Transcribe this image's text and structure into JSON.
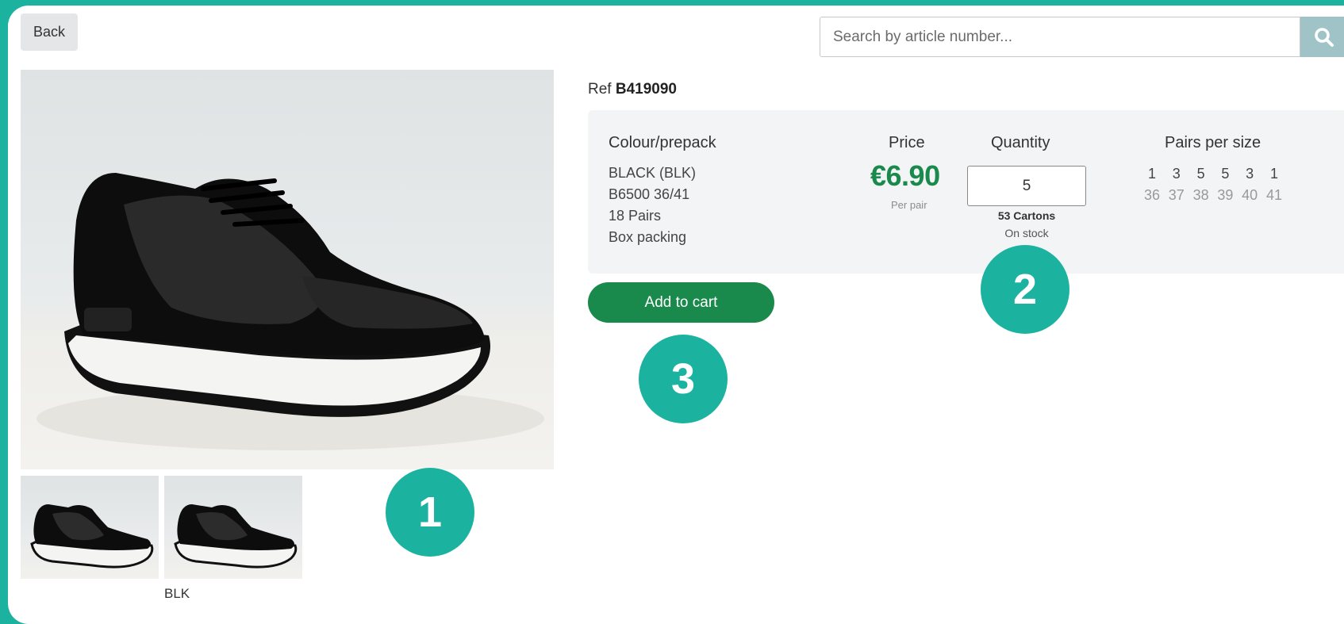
{
  "header": {
    "back_label": "Back",
    "search": {
      "placeholder": "Search by article number...",
      "value": ""
    }
  },
  "product": {
    "ref_prefix": "Ref",
    "ref_number": "B419090",
    "thumb_label": "BLK"
  },
  "details": {
    "colour_header": "Colour/prepack",
    "colour_lines": [
      "BLACK (BLK)",
      "B6500 36/41",
      "18 Pairs",
      "Box packing"
    ],
    "price_header": "Price",
    "price": "€6.90",
    "per_pair": "Per pair",
    "quantity_header": "Quantity",
    "quantity_value": "5",
    "cartons": "53 Cartons",
    "stock": "On stock",
    "sizes_header": "Pairs per size",
    "pairs": [
      "1",
      "3",
      "5",
      "5",
      "3",
      "1"
    ],
    "sizes": [
      "36",
      "37",
      "38",
      "39",
      "40",
      "41"
    ]
  },
  "actions": {
    "add_to_cart": "Add to cart"
  },
  "markers": [
    "1",
    "2",
    "3"
  ],
  "colors": {
    "frame": "#1bb3a0",
    "price": "#1a8a4c",
    "add_button": "#1a8a4c",
    "search_button": "#9fc3c6"
  }
}
